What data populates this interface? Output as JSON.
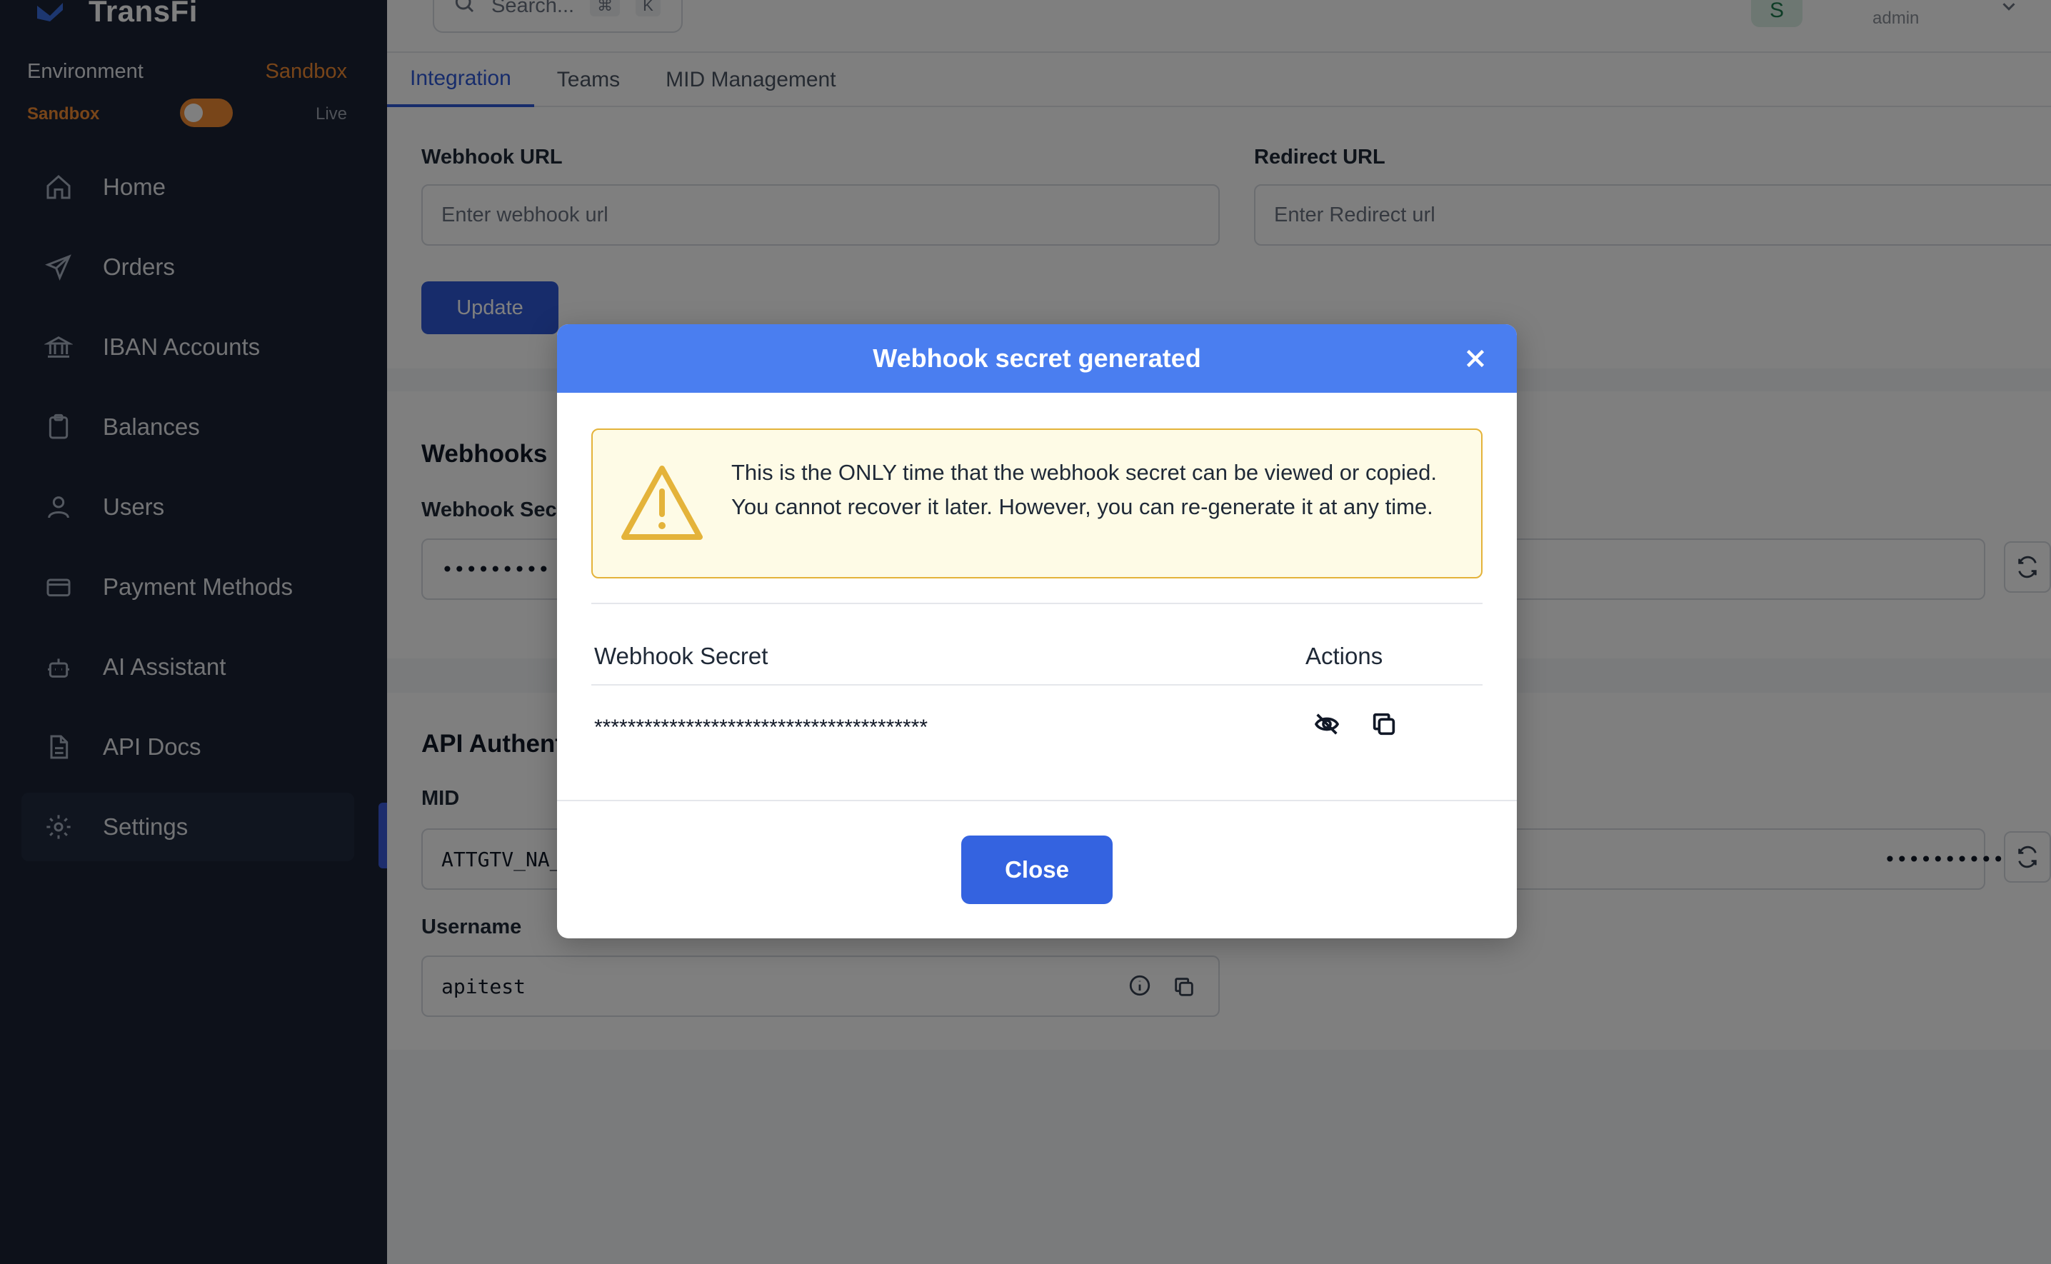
{
  "brand": {
    "name": "TransFi"
  },
  "environment": {
    "label": "Environment",
    "current": "Sandbox",
    "toggle_left": "Sandbox",
    "toggle_right": "Live",
    "toggle_color": "#f08a33"
  },
  "sidebar": {
    "items": [
      {
        "label": "Home",
        "icon": "home-icon"
      },
      {
        "label": "Orders",
        "icon": "send-icon"
      },
      {
        "label": "IBAN Accounts",
        "icon": "bank-icon"
      },
      {
        "label": "Balances",
        "icon": "clipboard-icon"
      },
      {
        "label": "Users",
        "icon": "user-icon"
      },
      {
        "label": "Payment Methods",
        "icon": "credit-card-icon"
      },
      {
        "label": "AI Assistant",
        "icon": "robot-icon"
      },
      {
        "label": "API Docs",
        "icon": "document-icon"
      },
      {
        "label": "Settings",
        "icon": "gear-icon"
      }
    ],
    "active": "Settings"
  },
  "topbar": {
    "search_placeholder": "Search...",
    "shortcut_mod": "⌘",
    "shortcut_key": "K",
    "avatar_initial": "S",
    "user_role": "admin"
  },
  "tabs": [
    {
      "label": "Integration",
      "active": true
    },
    {
      "label": "Teams",
      "active": false
    },
    {
      "label": "MID Management",
      "active": false
    }
  ],
  "integration": {
    "webhook_url_label": "Webhook URL",
    "webhook_url_placeholder": "Enter webhook url",
    "redirect_url_label": "Redirect URL",
    "redirect_url_placeholder": "Enter Redirect url",
    "update_label": "Update"
  },
  "webhooks": {
    "title": "Webhooks",
    "secret_label": "Webhook Secr",
    "secret_masked": "•••••••••"
  },
  "api_auth": {
    "title": "API Authenti",
    "mid_label": "MID",
    "mid_value": "ATTGTV_NA_",
    "right_masked": "•••••••••••",
    "username_label": "Username",
    "username_value": "apitest"
  },
  "modal": {
    "title": "Webhook secret generated",
    "warning_text": "This is the ONLY time that the webhook secret can be viewed or copied. You cannot recover it later. However, you can re-generate it at any time.",
    "col_secret": "Webhook Secret",
    "col_actions": "Actions",
    "secret_value": "****************************************",
    "close_label": "Close",
    "header_color": "#4a7ef0",
    "warning_color": "#e4b33a"
  }
}
